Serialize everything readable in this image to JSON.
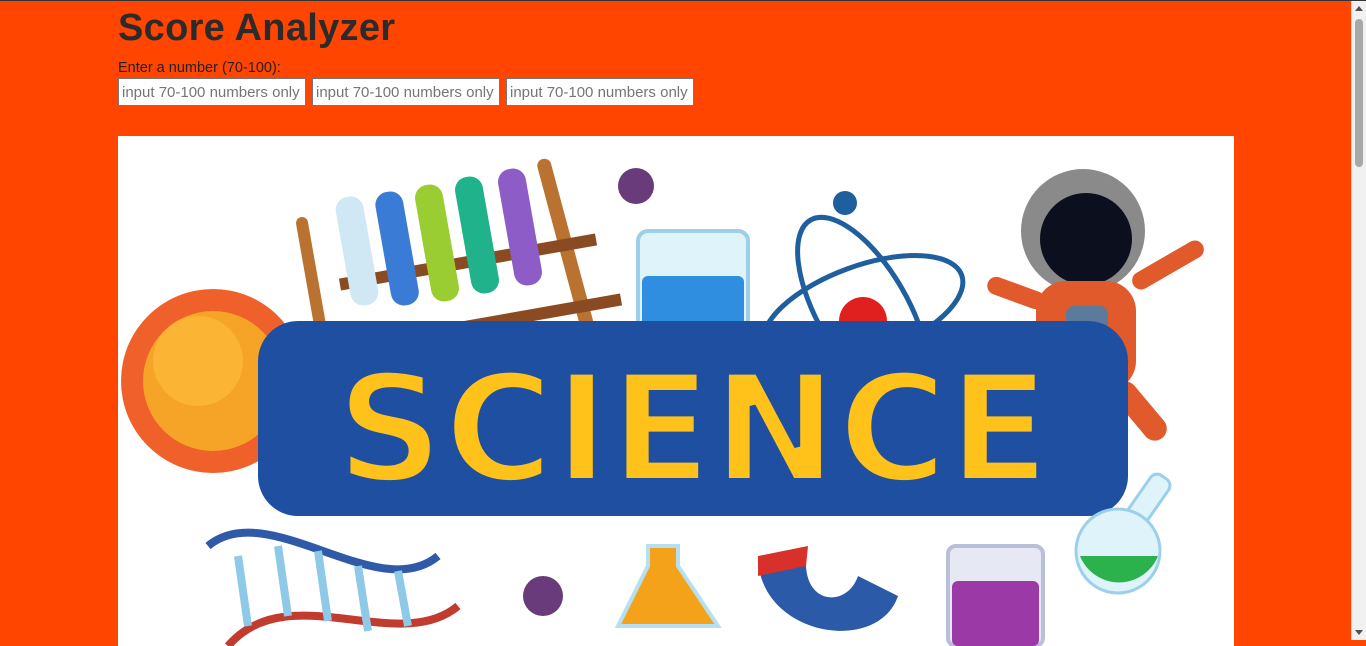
{
  "header": {
    "title": "Score Analyzer"
  },
  "form": {
    "prompt_label": "Enter a number (70-100):",
    "inputs": [
      {
        "value": "",
        "placeholder": "input 70-100 numbers only"
      },
      {
        "value": "",
        "placeholder": "input 70-100 numbers only"
      },
      {
        "value": "",
        "placeholder": "input 70-100 numbers only"
      }
    ]
  },
  "banner": {
    "text": "SCIENCE"
  },
  "colors": {
    "background": "#ff4500",
    "title": "#2b2b2b",
    "banner_fill": "#ffc21a",
    "banner_outline": "#1f4fa0"
  }
}
